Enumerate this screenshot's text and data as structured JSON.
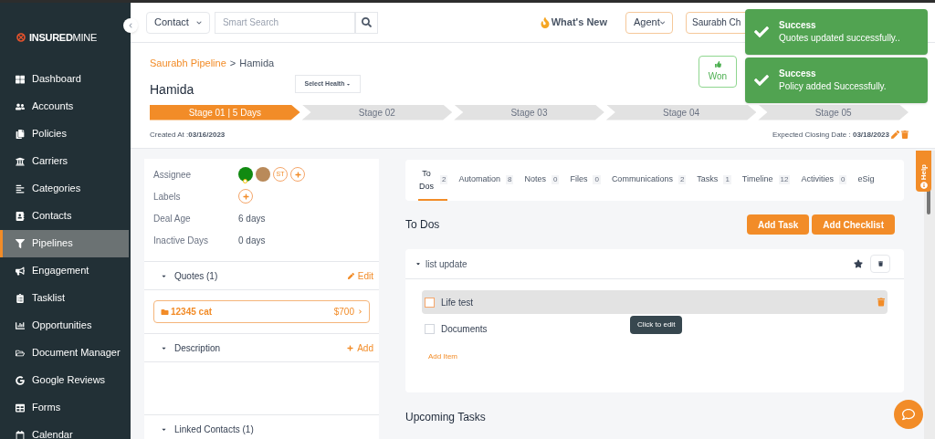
{
  "sidebar": {
    "logo": {
      "strong": "INSURED",
      "light": "MINE"
    },
    "items": [
      {
        "label": "Dashboard",
        "selected": false
      },
      {
        "label": "Accounts",
        "selected": false
      },
      {
        "label": "Policies",
        "selected": false
      },
      {
        "label": "Carriers",
        "selected": false
      },
      {
        "label": "Categories",
        "selected": false
      },
      {
        "label": "Contacts",
        "selected": false
      },
      {
        "label": "Pipelines",
        "selected": true
      },
      {
        "label": "Engagement",
        "selected": false
      },
      {
        "label": "Tasklist",
        "selected": false
      },
      {
        "label": "Opportunities",
        "selected": false
      },
      {
        "label": "Document Manager",
        "selected": false
      },
      {
        "label": "Google Reviews",
        "selected": false
      },
      {
        "label": "Forms",
        "selected": false
      },
      {
        "label": "Calendar",
        "selected": false
      }
    ]
  },
  "header": {
    "search_scope": "Contact",
    "search_placeholder": "Smart Search",
    "whats_new": "What's New",
    "role": "Agent",
    "user": "Saurabh Ch"
  },
  "deal": {
    "breadcrumb": {
      "parent": "Saurabh Pipeline",
      "separator": ">",
      "current": "Hamida"
    },
    "name": "Hamida",
    "health": "Select Health",
    "won": "Won",
    "stages": [
      {
        "label": "Stage 01 | 5 Days",
        "selected": true
      },
      {
        "label": "Stage 02",
        "selected": false
      },
      {
        "label": "Stage 03",
        "selected": false
      },
      {
        "label": "Stage 04",
        "selected": false
      },
      {
        "label": "Stage 05",
        "selected": false
      }
    ],
    "created_label": "Created At :",
    "created": "03/16/2023",
    "closing_label": "Expected Closing Date :",
    "closing": "03/18/2023"
  },
  "details": {
    "fields": [
      {
        "kind": "avatars",
        "label": "Assignee",
        "avatars": [
          {
            "kind": "online"
          },
          {
            "kind": "photo"
          },
          {
            "kind": "initials",
            "text": "ST"
          }
        ]
      },
      {
        "kind": "add",
        "label": "Labels"
      },
      {
        "kind": "text",
        "label": "Deal Age",
        "value": "6 days"
      },
      {
        "kind": "text",
        "label": "Inactive Days",
        "value": "0 days"
      }
    ],
    "sections": [
      {
        "title": "Quotes (1)",
        "action": {
          "kind": "edit",
          "label": "Edit"
        },
        "quotes": [
          {
            "name": "12345 cat",
            "amount": "$700"
          }
        ]
      },
      {
        "title": "Description",
        "action": {
          "kind": "add",
          "label": "Add"
        }
      },
      {
        "title": "Linked Contacts (1)"
      }
    ]
  },
  "tabs": [
    {
      "label": "To Dos",
      "count": "2",
      "selected": true
    },
    {
      "label": "Automation",
      "count": "8",
      "selected": false
    },
    {
      "label": "Notes",
      "count": "0",
      "selected": false
    },
    {
      "label": "Files",
      "count": "0",
      "selected": false
    },
    {
      "label": "Communications",
      "count": "2",
      "selected": false
    },
    {
      "label": "Tasks",
      "count": "1",
      "selected": false
    },
    {
      "label": "Timeline",
      "count": "12",
      "selected": false
    },
    {
      "label": "Activities",
      "count": "0",
      "selected": false
    },
    {
      "label": "eSig",
      "selected": false
    }
  ],
  "todos": {
    "title": "To Dos",
    "buttons": [
      "Add Task",
      "Add Checklist"
    ],
    "checklists": [
      {
        "title": "list update",
        "items": [
          {
            "label": "Life test",
            "checked": false,
            "hovered": true
          },
          {
            "label": "Documents",
            "checked": false,
            "hovered": false
          }
        ],
        "add_item": "Add Item"
      }
    ],
    "tooltip": "Click to edit"
  },
  "upcoming": {
    "title": "Upcoming Tasks"
  },
  "help": "Help",
  "toasts": [
    {
      "title": "Success",
      "message": "Quotes updated successfully.."
    },
    {
      "title": "Success",
      "message": "Policy added Successfully."
    }
  ]
}
